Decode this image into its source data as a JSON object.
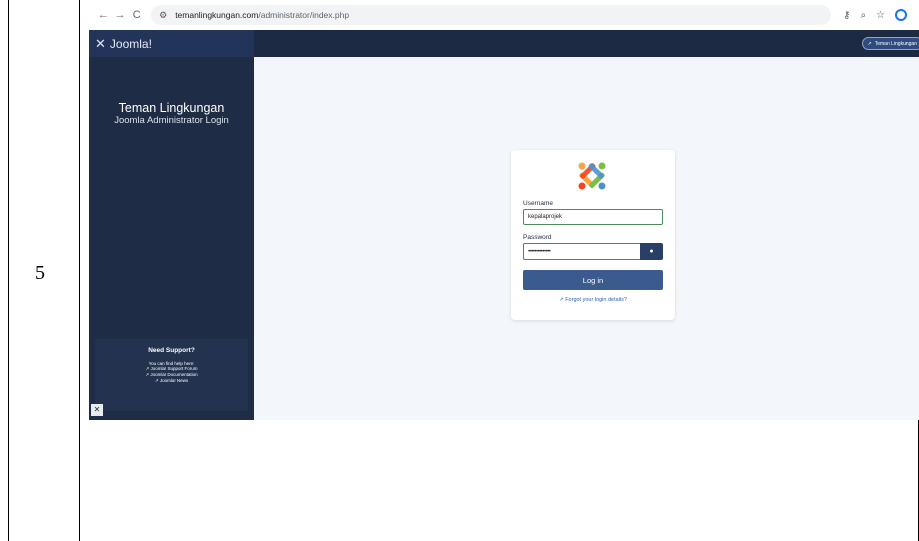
{
  "document": {
    "row_number": "5"
  },
  "browser": {
    "nav": {
      "back": "←",
      "forward": "→",
      "reload": "C"
    },
    "url_host": "temanlingkungan.com",
    "url_path": "/administrator/index.php",
    "icons": [
      "key-icon",
      "zoom-icon",
      "star-icon",
      "profile-icon",
      "menu-icon"
    ]
  },
  "header": {
    "brand": "Joomla!",
    "site_button": "Teman Lingkungan"
  },
  "sidebar": {
    "title": "Teman Lingkungan",
    "subtitle": "Joomla Administrator Login",
    "support": {
      "heading": "Need Support?",
      "intro": "You can find help here:",
      "links": [
        "Joomla! Support Forum",
        "Joomla! Documentation",
        "Joomla! News"
      ]
    }
  },
  "login": {
    "username_label": "Username",
    "username_value": "kepalaprojek",
    "password_label": "Password",
    "password_value": "••••••••••••••",
    "login_button": "Log in",
    "forgot_link": "Forgot your login details?"
  },
  "colors": {
    "header_bg": "#1c2a43",
    "sidebar_bg": "#1f2c45",
    "button_bg": "#3b5b8f",
    "input_border": "#4f8a5c",
    "link": "#3460b2"
  }
}
